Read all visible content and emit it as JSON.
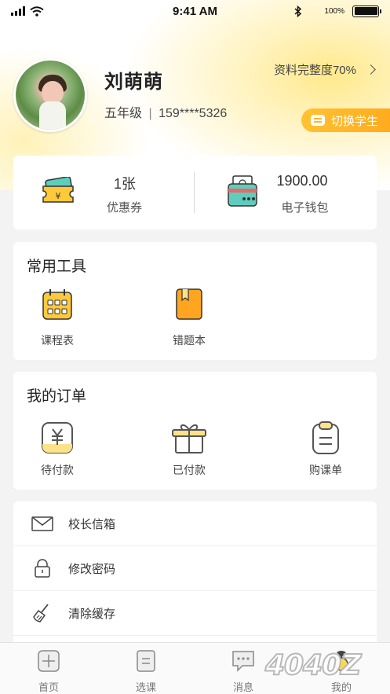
{
  "status_bar": {
    "time": "9:41 AM",
    "battery": "100%"
  },
  "profile": {
    "name": "刘萌萌",
    "grade": "五年级",
    "phone": "159****5326",
    "completeness": "资料完整度70%",
    "switch_label": "切换学生"
  },
  "wallet": {
    "coupon_value": "1张",
    "coupon_label": "优惠券",
    "balance_value": "1900.00",
    "balance_label": "电子钱包"
  },
  "tools": {
    "title": "常用工具",
    "items": [
      {
        "label": "课程表",
        "icon": "calendar-icon"
      },
      {
        "label": "错题本",
        "icon": "notebook-icon"
      }
    ]
  },
  "orders": {
    "title": "我的订单",
    "items": [
      {
        "label": "待付款",
        "icon": "yen-wallet-icon"
      },
      {
        "label": "已付款",
        "icon": "gift-box-icon"
      },
      {
        "label": "购课单",
        "icon": "clipboard-icon"
      }
    ]
  },
  "settings": [
    {
      "label": "校长信箱",
      "icon": "mail-icon"
    },
    {
      "label": "修改密码",
      "icon": "lock-icon"
    },
    {
      "label": "清除缓存",
      "icon": "broom-icon"
    }
  ],
  "tab_bar": [
    {
      "label": "首页",
      "icon": "home-icon"
    },
    {
      "label": "选课",
      "icon": "course-icon"
    },
    {
      "label": "消息",
      "icon": "message-icon"
    },
    {
      "label": "我的",
      "icon": "profile-icon"
    }
  ],
  "watermark": "4040Z",
  "colors": {
    "accent": "#ffb52a",
    "accent_light": "#fde28a",
    "teal": "#5fcdbd"
  }
}
